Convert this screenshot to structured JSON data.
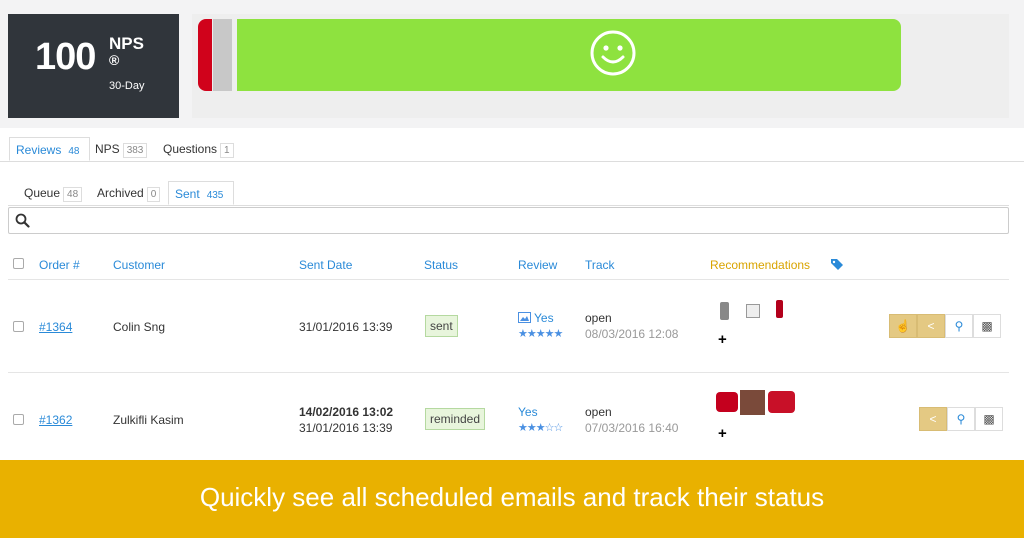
{
  "nps": {
    "score": "100",
    "label": "NPS",
    "registered": "®",
    "period": "30-Day"
  },
  "colors": {
    "detractor": "#d0021b",
    "passive": "#c8c8c8",
    "promoter": "#8ee23f",
    "accent": "#2a8ad8",
    "banner": "#e9b100"
  },
  "main_tabs": [
    {
      "label": "Reviews",
      "count": "48"
    },
    {
      "label": "NPS",
      "count": "383"
    },
    {
      "label": "Questions",
      "count": "1"
    }
  ],
  "sub_tabs": [
    {
      "label": "Queue",
      "count": "48"
    },
    {
      "label": "Archived",
      "count": "0"
    },
    {
      "label": "Sent",
      "count": "435"
    }
  ],
  "search": {
    "placeholder": ""
  },
  "columns": {
    "order": "Order #",
    "customer": "Customer",
    "sent_date": "Sent Date",
    "status": "Status",
    "review": "Review",
    "track": "Track",
    "recommendations": "Recommendations"
  },
  "rows": [
    {
      "order": "#1364",
      "customer": "Colin Sng",
      "sent_date": "31/01/2016 13:39",
      "sent_date_2": "",
      "status": "sent",
      "review": "Yes",
      "review_rating": 5,
      "track_status": "open",
      "track_date": "08/03/2016 12:08",
      "add": "+"
    },
    {
      "order": "#1362",
      "customer": "Zulkifli Kasim",
      "sent_date": "14/02/2016 13:02",
      "sent_date_2": "31/01/2016 13:39",
      "status": "reminded",
      "review": "Yes",
      "review_rating": 3,
      "track_status": "open",
      "track_date": "07/03/2016 16:40",
      "add": "+"
    }
  ],
  "icons": {
    "search": "search-icon",
    "smiley": "smiley-icon",
    "tag": "tag-icon",
    "picture": "picture-icon",
    "hand": "hand-pointer-icon",
    "share": "share-icon",
    "zoom": "zoom-in-icon",
    "trash": "trash-icon"
  },
  "banner": {
    "text": "Quickly see all scheduled emails and track their status"
  }
}
